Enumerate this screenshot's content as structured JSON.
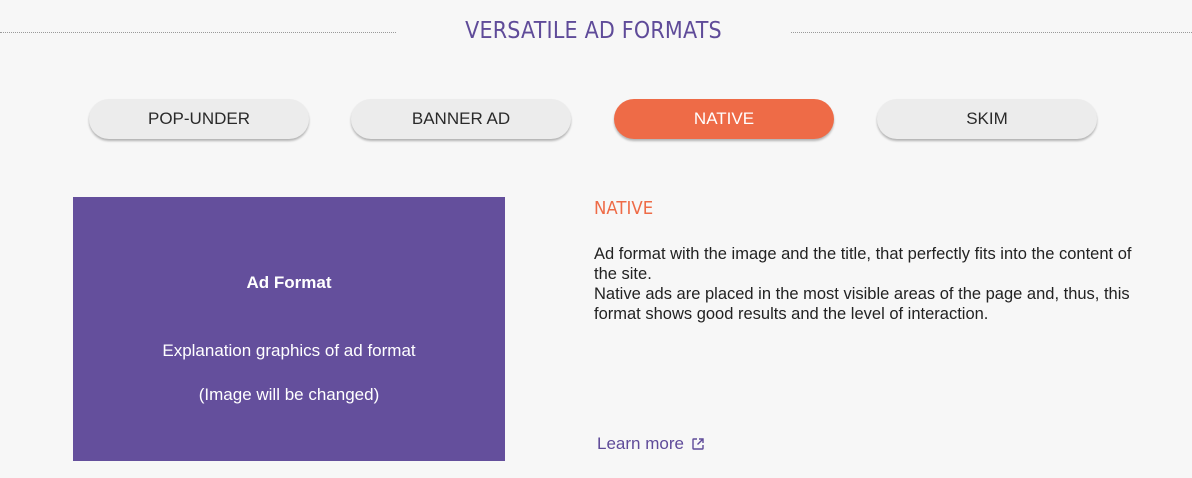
{
  "header": {
    "title": "VERSATILE AD FORMATS"
  },
  "tabs": [
    {
      "label": "POP-UNDER",
      "active": false
    },
    {
      "label": "BANNER AD",
      "active": false
    },
    {
      "label": "NATIVE",
      "active": true
    },
    {
      "label": "SKIM",
      "active": false
    }
  ],
  "graphic": {
    "title": "Ad Format",
    "line1": "Explanation graphics of ad format",
    "line2": "(Image will be changed)",
    "background_color": "#644f9c"
  },
  "description": {
    "title": "NATIVE",
    "paragraphs": [
      "Ad format with the image and the title, that perfectly fits into the content of the site.",
      "Native ads are placed in the most visible areas of the page and, thus, this format shows good results and the level of interaction."
    ],
    "learn_more": "Learn more",
    "learn_more_icon": "external-link-icon"
  },
  "colors": {
    "accent": "#ee6b47",
    "brand": "#5f4b99",
    "background": "#f7f7f7"
  }
}
